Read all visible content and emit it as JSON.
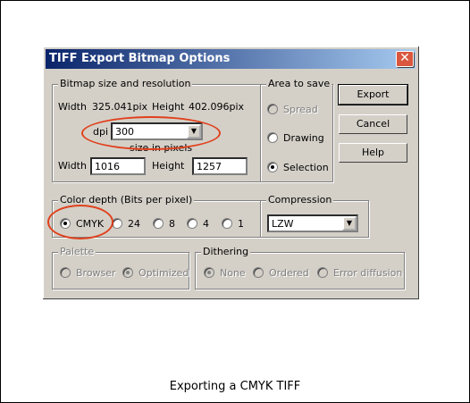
{
  "dialog": {
    "title": "TIFF Export Bitmap Options",
    "close_label": "✕"
  },
  "bitmap": {
    "legend": "Bitmap size and resolution",
    "width_label": "Width",
    "width_value": "325.041pix",
    "height_label": "Height",
    "height_value": "402.096pix",
    "dpi_label": "dpi",
    "dpi_value": "300",
    "size_pixels_label": "size in pixels",
    "px_width_label": "Width",
    "px_width_value": "1016",
    "px_height_label": "Height",
    "px_height_value": "1257"
  },
  "area": {
    "legend": "Area to save",
    "options": [
      "Spread",
      "Drawing",
      "Selection"
    ],
    "selected": "Selection"
  },
  "buttons": {
    "export": "Export",
    "cancel": "Cancel",
    "help": "Help"
  },
  "color_depth": {
    "legend": "Color depth (Bits per pixel)",
    "options": [
      "CMYK",
      "24",
      "8",
      "4",
      "1"
    ],
    "selected": "CMYK"
  },
  "compression": {
    "legend": "Compression",
    "value": "LZW"
  },
  "palette": {
    "legend": "Palette",
    "options": [
      "Browser",
      "Optimized"
    ],
    "selected": "Optimized"
  },
  "dithering": {
    "legend": "Dithering",
    "options": [
      "None",
      "Ordered",
      "Error diffusion"
    ],
    "selected": "None"
  },
  "colors": {
    "highlight_oval": "#e0401c",
    "titlebar_start": "#0a246a",
    "titlebar_end": "#a6caf0",
    "dialog_bg": "#d4d0c8"
  },
  "caption": "Exporting a CMYK TIFF"
}
